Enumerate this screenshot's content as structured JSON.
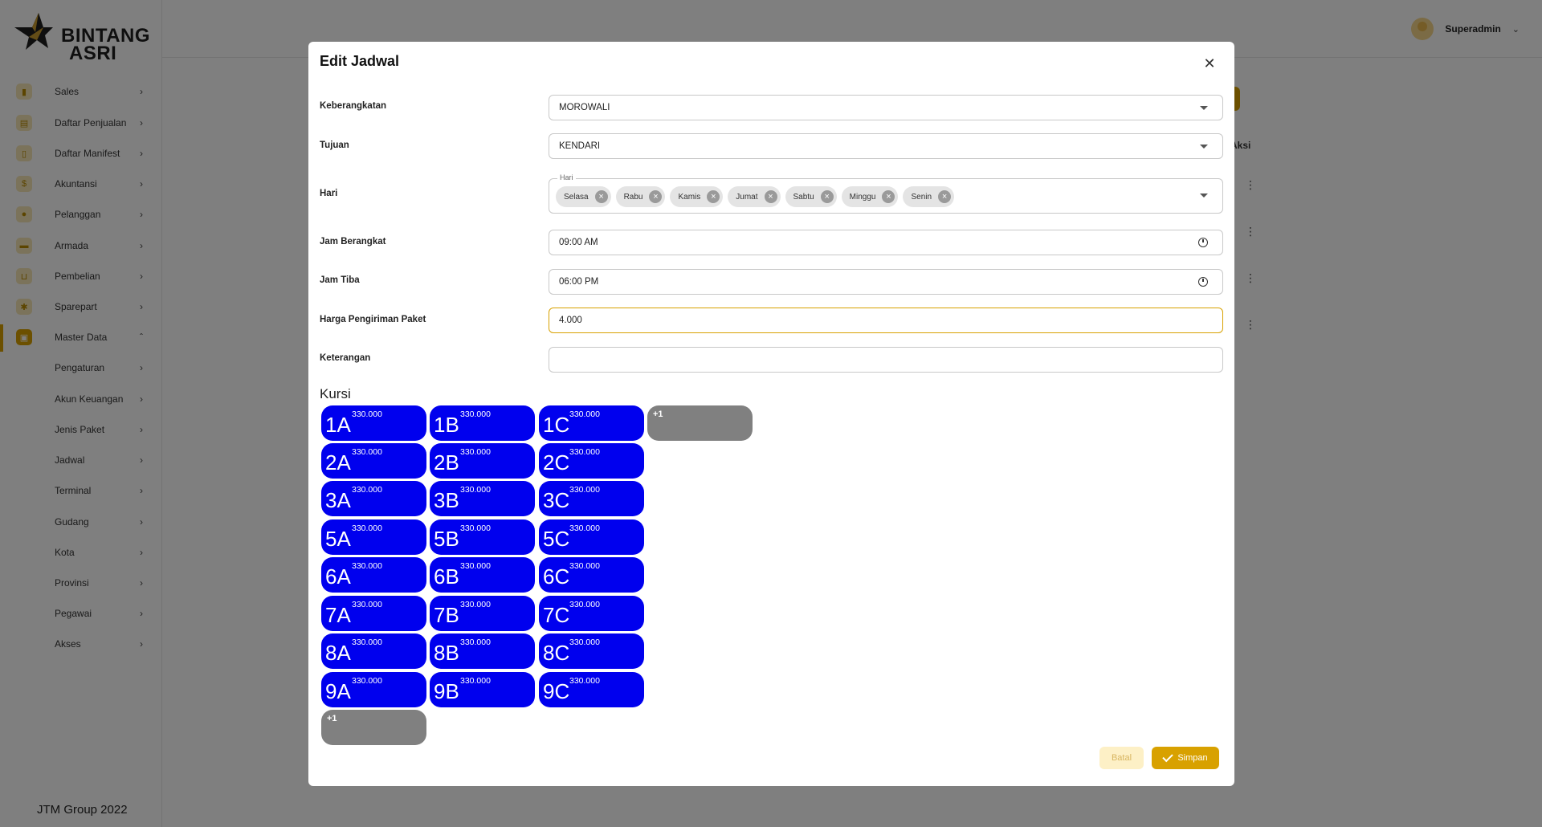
{
  "brand": {
    "line1": "BINTANG",
    "line2": "ASRI"
  },
  "sidebar": {
    "items": [
      {
        "label": "Sales"
      },
      {
        "label": "Daftar Penjualan"
      },
      {
        "label": "Daftar Manifest"
      },
      {
        "label": "Akuntansi"
      },
      {
        "label": "Pelanggan"
      },
      {
        "label": "Armada"
      },
      {
        "label": "Pembelian"
      },
      {
        "label": "Sparepart"
      },
      {
        "label": "Master Data"
      }
    ],
    "sub_items": [
      {
        "label": "Pengaturan"
      },
      {
        "label": "Akun Keuangan"
      },
      {
        "label": "Jenis Paket"
      },
      {
        "label": "Jadwal"
      },
      {
        "label": "Terminal"
      },
      {
        "label": "Gudang"
      },
      {
        "label": "Kota"
      },
      {
        "label": "Provinsi"
      },
      {
        "label": "Pegawai"
      },
      {
        "label": "Akses"
      }
    ],
    "footer": "JTM Group 2022"
  },
  "topbar": {
    "user_name": "Superadmin"
  },
  "background": {
    "aksi_header": "Aksi"
  },
  "modal": {
    "title": "Edit Jadwal",
    "fields": {
      "keberangkatan": {
        "label": "Keberangkatan",
        "value": "MOROWALI"
      },
      "tujuan": {
        "label": "Tujuan",
        "value": "KENDARI"
      },
      "hari": {
        "label": "Hari",
        "legend": "Hari",
        "chips": [
          "Selasa",
          "Rabu",
          "Kamis",
          "Jumat",
          "Sabtu",
          "Minggu",
          "Senin"
        ]
      },
      "jam_berangkat": {
        "label": "Jam Berangkat",
        "value": "09:00 AM"
      },
      "jam_tiba": {
        "label": "Jam Tiba",
        "value": "06:00 PM"
      },
      "harga": {
        "label": "Harga Pengiriman Paket",
        "value": "4.000"
      },
      "keterangan": {
        "label": "Keterangan",
        "value": ""
      }
    },
    "kursi_title": "Kursi",
    "seats": [
      {
        "name": "1A",
        "price": "330.000"
      },
      {
        "name": "1B",
        "price": "330.000"
      },
      {
        "name": "1C",
        "price": "330.000"
      },
      {
        "name": "",
        "price": "+1"
      },
      {
        "name": "2A",
        "price": "330.000"
      },
      {
        "name": "2B",
        "price": "330.000"
      },
      {
        "name": "2C",
        "price": "330.000"
      },
      {
        "name": "3A",
        "price": "330.000"
      },
      {
        "name": "3B",
        "price": "330.000"
      },
      {
        "name": "3C",
        "price": "330.000"
      },
      {
        "name": "5A",
        "price": "330.000"
      },
      {
        "name": "5B",
        "price": "330.000"
      },
      {
        "name": "5C",
        "price": "330.000"
      },
      {
        "name": "6A",
        "price": "330.000"
      },
      {
        "name": "6B",
        "price": "330.000"
      },
      {
        "name": "6C",
        "price": "330.000"
      },
      {
        "name": "7A",
        "price": "330.000"
      },
      {
        "name": "7B",
        "price": "330.000"
      },
      {
        "name": "7C",
        "price": "330.000"
      },
      {
        "name": "8A",
        "price": "330.000"
      },
      {
        "name": "8B",
        "price": "330.000"
      },
      {
        "name": "8C",
        "price": "330.000"
      },
      {
        "name": "9A",
        "price": "330.000"
      },
      {
        "name": "9B",
        "price": "330.000"
      },
      {
        "name": "9C",
        "price": "330.000"
      },
      {
        "name": "",
        "price": "+1"
      }
    ],
    "buttons": {
      "cancel": "Batal",
      "save": "Simpan"
    }
  },
  "colors": {
    "accent": "#d8a100",
    "seat": "#0000ee",
    "seat_add": "#808080"
  }
}
